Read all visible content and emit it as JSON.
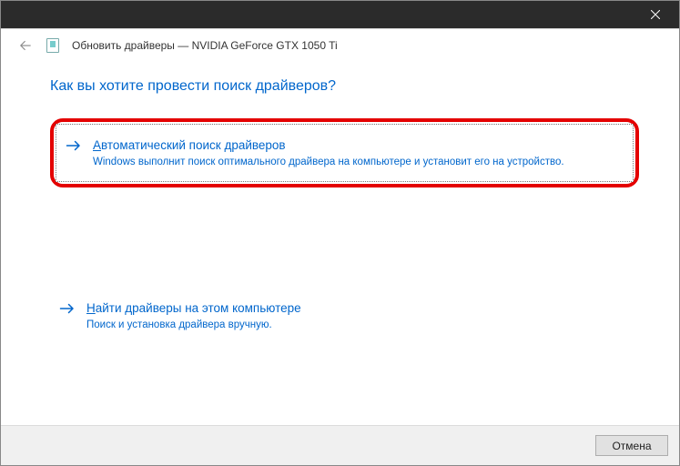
{
  "titlebar": {
    "close_tooltip": "Close"
  },
  "header": {
    "title": "Обновить драйверы — NVIDIA GeForce GTX 1050 Ti"
  },
  "content": {
    "heading": "Как вы хотите провести поиск драйверов?",
    "option_auto": {
      "accel": "А",
      "title_rest": "втоматический поиск драйверов",
      "desc": "Windows выполнит поиск оптимального драйвера на компьютере и установит его на устройство."
    },
    "option_local": {
      "accel": "Н",
      "title_rest": "айти драйверы на этом компьютере",
      "desc": "Поиск и установка драйвера вручную."
    }
  },
  "footer": {
    "cancel_label": "Отмена"
  }
}
